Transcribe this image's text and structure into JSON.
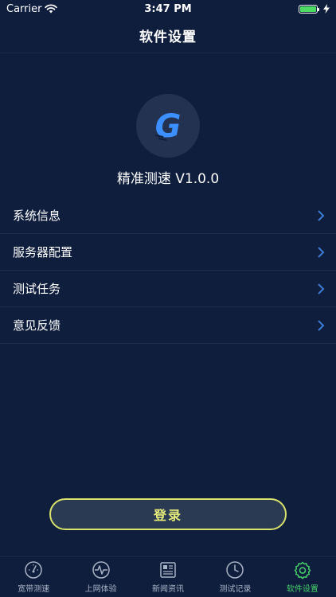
{
  "status_bar": {
    "carrier": "Carrier",
    "time": "3:47 PM"
  },
  "nav": {
    "title": "软件设置"
  },
  "app": {
    "name": "精准测速 V1.0.0",
    "logo_letter": "G"
  },
  "menu": {
    "items": [
      {
        "label": "系统信息"
      },
      {
        "label": "服务器配置"
      },
      {
        "label": "测试任务"
      },
      {
        "label": "意见反馈"
      }
    ]
  },
  "login": {
    "label": "登录"
  },
  "tabs": [
    {
      "label": "宽带测速",
      "icon": "speedometer-icon",
      "active": false
    },
    {
      "label": "上网体验",
      "icon": "pulse-icon",
      "active": false
    },
    {
      "label": "新闻资讯",
      "icon": "newspaper-icon",
      "active": false
    },
    {
      "label": "测试记录",
      "icon": "clock-icon",
      "active": false
    },
    {
      "label": "软件设置",
      "icon": "gear-icon",
      "active": true
    }
  ],
  "colors": {
    "background": "#0f1e3d",
    "accent_active": "#47d16a",
    "login_border": "#d9e26a",
    "logo_blue": "#3b8fff"
  }
}
